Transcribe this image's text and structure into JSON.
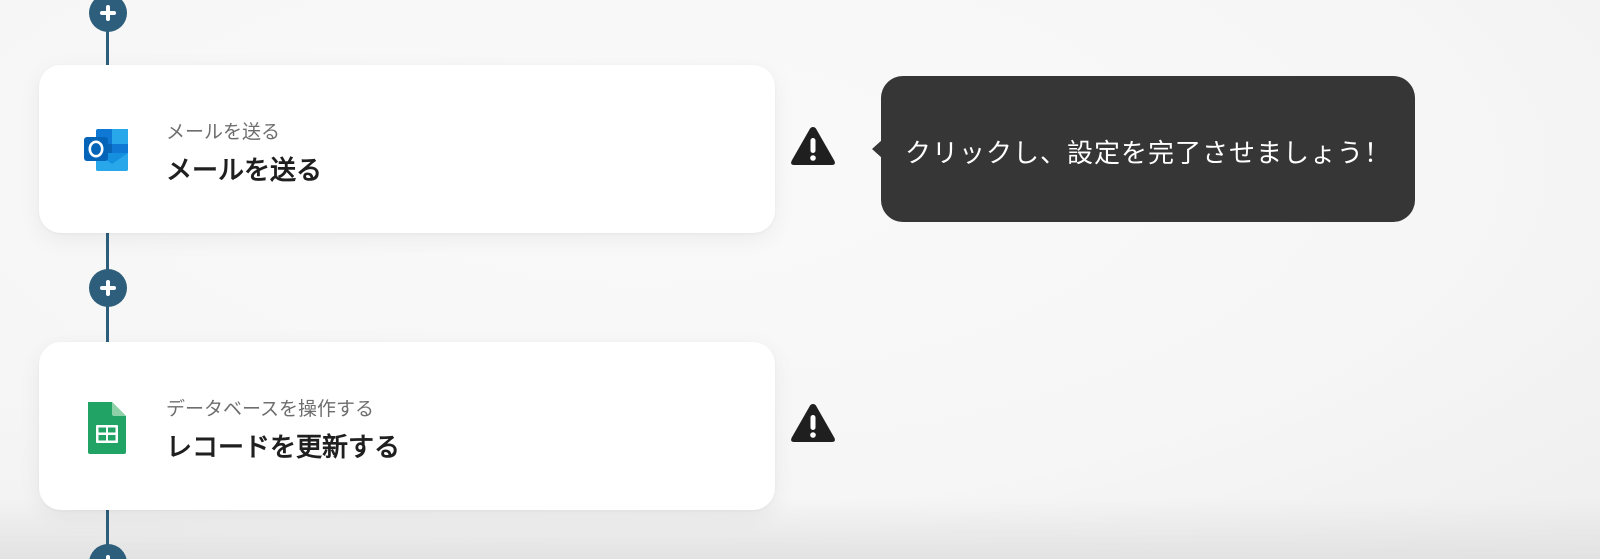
{
  "steps": [
    {
      "app_icon": "outlook-icon",
      "subtitle": "メールを送る",
      "title": "メールを送る",
      "status_icon": "warning-icon"
    },
    {
      "app_icon": "google-sheets-icon",
      "subtitle": "データベースを操作する",
      "title": "レコードを更新する",
      "status_icon": "warning-icon"
    }
  ],
  "tooltip": {
    "text": "クリックし、設定を完了させましょう！"
  },
  "colors": {
    "connector": "#2d5f7c",
    "tooltip_bg": "#363636",
    "warning": "#1f1f1f"
  }
}
